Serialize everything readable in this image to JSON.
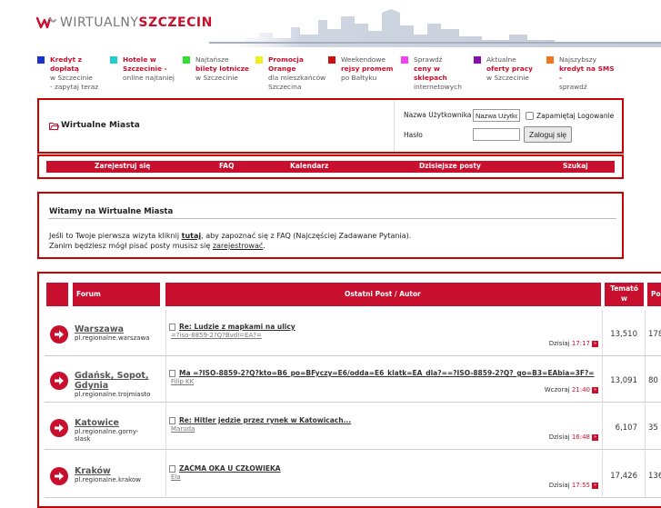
{
  "header": {
    "logo_part1": "WIRTUALNY",
    "logo_part2": "SZCZECIN"
  },
  "ads": [
    {
      "color": "#1a33cc",
      "title": "Kredyt z dopłatą",
      "line2": "w Szczecinie",
      "line3": "- zapytaj teraz"
    },
    {
      "color": "#22cccc",
      "title": "Hotele w Szczecinie -",
      "line2": "online najtaniej",
      "line3": ""
    },
    {
      "color": "#33dd33",
      "pre": "Najtańsze",
      "title": "bilety lotnicze",
      "line2": "w Szczecinie",
      "line3": ""
    },
    {
      "color": "#eeee22",
      "title": "Promocja Orange",
      "line2": "dla mieszkańców",
      "line3": "Szczecina"
    },
    {
      "color": "#cc1111",
      "pre": "Weekendowe",
      "title": "rejsy promem",
      "line2": "po Bałtyku",
      "line3": ""
    },
    {
      "color": "#ee44ee",
      "pre": "Sprawdź",
      "title": "ceny w sklepach",
      "line2": "internetowych",
      "line3": ""
    },
    {
      "color": "#8811aa",
      "pre": "Aktualne",
      "title": "oferty pracy",
      "line2": "w Szczecinie",
      "line3": ""
    },
    {
      "color": "#ee7722",
      "pre": "Najszybszy",
      "title": "kredyt na SMS",
      "title_suffix": " -",
      "line2": "sprawdź",
      "line3": ""
    }
  ],
  "login": {
    "title": "Wirtualne Miasta",
    "username_label": "Nazwa Użytkownika",
    "username_value": "Nazwa Użytko",
    "remember_label": "Zapamiętaj Logowanie",
    "password_label": "Hasło",
    "password_value": "",
    "login_button": "Zaloguj się"
  },
  "nav": {
    "register": "Zarejestruj się",
    "faq": "FAQ",
    "calendar": "Kalendarz",
    "today_posts": "Dzisiejsze posty",
    "search": "Szukaj"
  },
  "welcome": {
    "title": "Witamy na Wirtualne Miasta",
    "line1_a": "Jeśli to Twoje pierwsza wizyta kliknij ",
    "line1_link": "tutaj",
    "line1_b": ", aby zapoznać się z FAQ (Najczęściej Zadawane Pytania).",
    "line2_a": "Zanim będziesz mógł pisać posty musisz się ",
    "line2_link": "zarejestrować",
    "line2_b": "."
  },
  "forum_table": {
    "col_forum": "Forum",
    "col_last_post": "Ostatni Post / Autor",
    "col_topics_1": "Temató",
    "col_topics_2": "w",
    "col_posts": "Pos",
    "rows": [
      {
        "name": "Warszawa",
        "name2": "",
        "group": "pl.regionalne.warszawa",
        "group2": "",
        "post_title": "Re: Ludzie z mapkami na ulicy",
        "author": "=?iso-8859-2?Q?Bvdl=EA?=",
        "date_label": "Dzisiaj",
        "time": "17:17",
        "topics": "13,510",
        "posts": "178"
      },
      {
        "name": "Gdańsk, Sopot,",
        "name2": "Gdynia",
        "group": "pl.regionalne.trojmiasto",
        "group2": "",
        "post_title": "Ma =?ISO-8859-2?Q?kto=B6_po=BFyczy=E6/odda=E6_klatk=EA_dla?==?ISO-8859-2?Q?_go=B3=EAbia=3F?=",
        "author": "Filip KK",
        "date_label": "Wczoraj",
        "time": "21:40",
        "topics": "13,091",
        "posts": "80"
      },
      {
        "name": "Katowice",
        "name2": "",
        "group": "pl.regionalne.gorny-",
        "group2": "slask",
        "post_title": "Re: Hitler jedzie przez rynek w Katowicach...",
        "author": "Maruda",
        "date_label": "Dzisiaj",
        "time": "16:48",
        "topics": "6,107",
        "posts": "35"
      },
      {
        "name": "Kraków",
        "name2": "",
        "group": "pl.regionalne.krakow",
        "group2": "",
        "post_title": "ZAĆMA OKA U CZŁOWIEKA",
        "author": "Ela",
        "date_label": "Dzisiaj",
        "time": "17:55",
        "topics": "17,426",
        "posts": "136"
      }
    ]
  }
}
